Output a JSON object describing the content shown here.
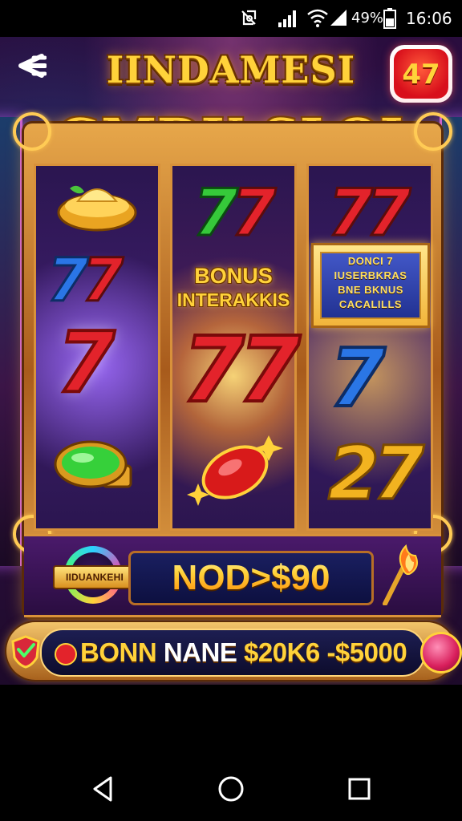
{
  "status_bar": {
    "battery_percent": "49%",
    "time": "16:06",
    "icons": [
      "do-not-disturb-icon",
      "signal-icon",
      "wifi-icon",
      "signal-2-icon",
      "battery-icon"
    ]
  },
  "header": {
    "title_top": "IINDAMESI",
    "title_main": "GMDK SLOI",
    "badge_number": "47"
  },
  "reels": {
    "center_bonus_line1": "BONUS",
    "center_bonus_line2": "INTERAKKIS",
    "info_card_lines": [
      "DONCI 7",
      "IUSERBKRAS",
      "BNE BKNUS",
      "CACALILLS"
    ]
  },
  "win_panel": {
    "logo_text": "IIDUANKEHI",
    "win_amount": "NOD>$90"
  },
  "bonus_bar": {
    "label_yellow": "BONN",
    "label_white": "NANE",
    "range": "$20K6 -$5000"
  },
  "nav": {
    "back": "back-icon",
    "home": "home-icon",
    "recents": "recents-icon"
  },
  "colors": {
    "gold": "#ffd23a",
    "purple_bg": "#3a1450",
    "frame": "#d8913a",
    "red_seven": "#e3232b",
    "green_seven": "#36c93a",
    "blue_seven": "#2a76e6"
  }
}
